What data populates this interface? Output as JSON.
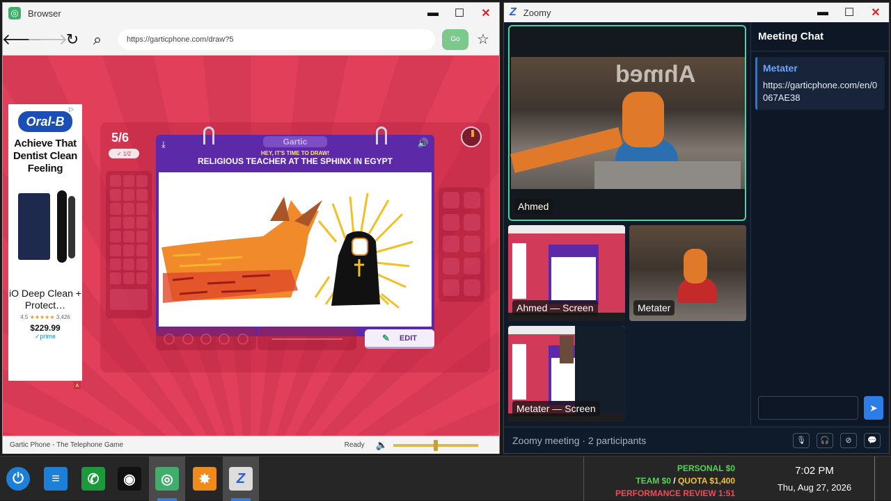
{
  "browser": {
    "title": "Browser",
    "url": "https://garticphone.com/draw?5",
    "go_label": "Go",
    "status_left": "Gartic Phone - The Telephone Game",
    "status_right": "Ready",
    "volume_level": 0.5
  },
  "ad": {
    "choice": "▷",
    "brand": "Oral-B",
    "headline": "Achieve That Dentist Clean Feeling",
    "product": "iO Deep Clean + Protect…",
    "rating": "4.5",
    "stars": "★★★★★",
    "reviews": "3,426",
    "price": "$229.99",
    "prime": "✓prime",
    "badge": "A"
  },
  "game": {
    "round": "5/6",
    "done_count": "1/2",
    "brand": "Gartic",
    "hey_text": "HEY, IT'S TIME TO DRAW!",
    "prompt": "RELIGIOUS TEACHER AT THE SPHINX IN EGYPT",
    "edit_label": "EDIT"
  },
  "zoomy": {
    "title": "Zoomy",
    "tiles": [
      {
        "label": "Ahmed"
      },
      {
        "label": "Ahmed — Screen"
      },
      {
        "label": "Metater"
      },
      {
        "label": "Metater — Screen"
      }
    ],
    "main_sign": "Ahmed",
    "chat": {
      "header": "Meeting Chat",
      "messages": [
        {
          "sender": "Metater",
          "text": "https://garticphone.com/en/0067AE38"
        }
      ],
      "send_icon": "send-icon"
    },
    "footer": "Zoomy meeting · 2 participants",
    "controls": [
      "mic-icon",
      "headphones-icon",
      "screen-share-off-icon",
      "chat-icon"
    ]
  },
  "taskbar": {
    "apps": [
      "power-icon",
      "notes-icon",
      "phone-icon",
      "camera-icon",
      "browser-icon",
      "map-icon",
      "zoomy-icon"
    ],
    "stats": {
      "personal": "PERSONAL $0",
      "team": "TEAM $0",
      "slash": "/",
      "quota": "QUOTA $1,400",
      "review": "PERFORMANCE REVIEW 1:51"
    },
    "time": "7:02 PM",
    "date": "Thu, Aug 27, 2026"
  }
}
